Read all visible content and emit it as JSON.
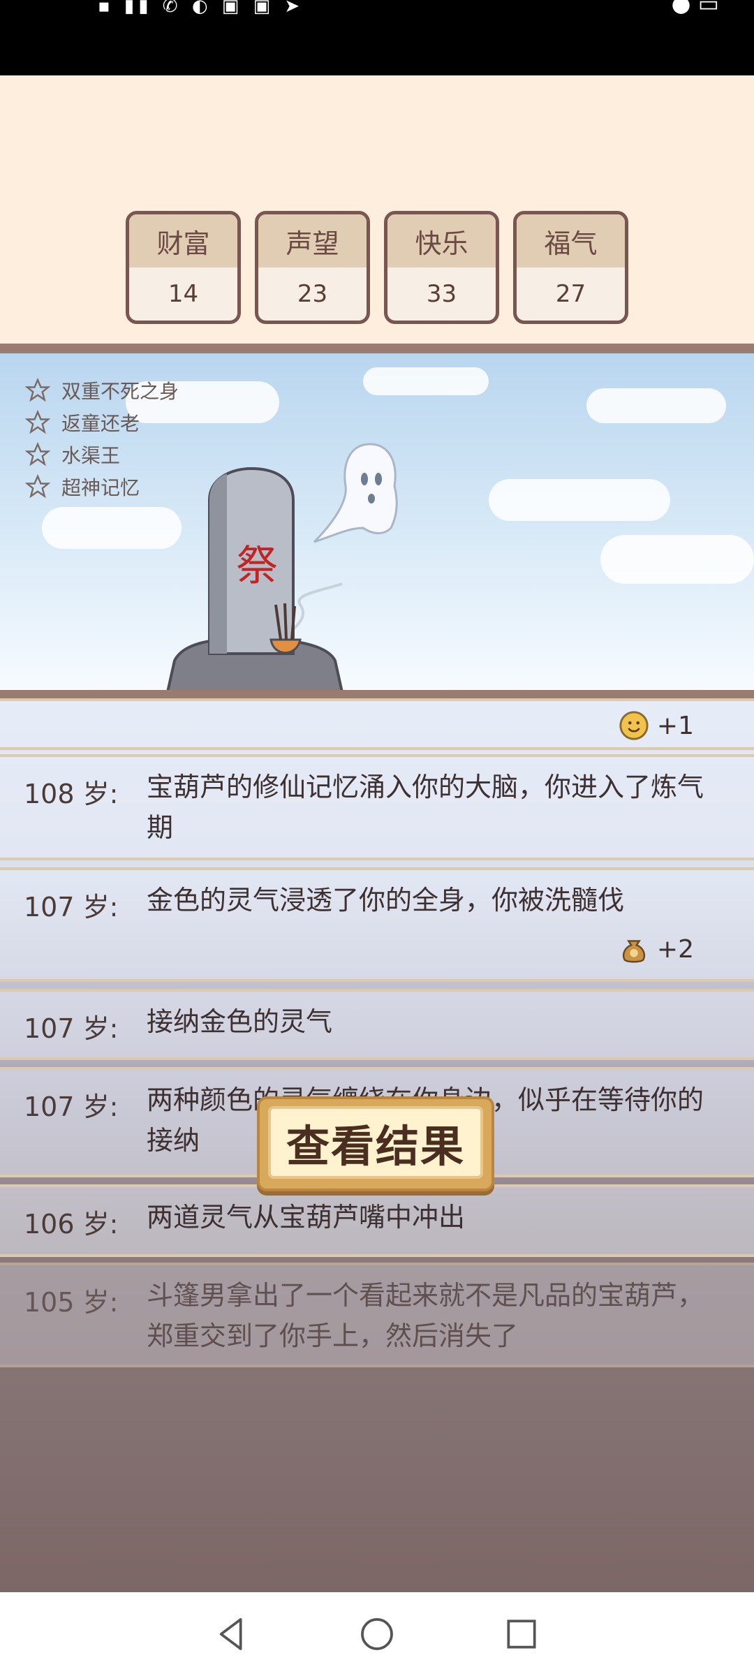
{
  "stats": [
    {
      "label": "财富",
      "value": "14"
    },
    {
      "label": "声望",
      "value": "23"
    },
    {
      "label": "快乐",
      "value": "33"
    },
    {
      "label": "福气",
      "value": "27"
    }
  ],
  "traits": [
    "双重不死之身",
    "返童还老",
    "水渠王",
    "超神记忆"
  ],
  "scene": {
    "tombstone_text": "祭"
  },
  "top_reward": {
    "icon": "smiley-icon",
    "text": "+1"
  },
  "log": [
    {
      "age": "108 岁:",
      "text": "宝葫芦的修仙记忆涌入你的大脑，你进入了炼气期"
    },
    {
      "age": "107 岁:",
      "text": "金色的灵气浸透了你的全身，你被洗髓伐",
      "reward": {
        "icon": "money-bag-icon",
        "text": "+2"
      }
    },
    {
      "age": "107 岁:",
      "text": "接纳金色的灵气"
    },
    {
      "age": "107 岁:",
      "text": "两种颜色的灵气缠绕在你身边，似乎在等待你的接纳"
    },
    {
      "age": "106 岁:",
      "text": "两道灵气从宝葫芦嘴中冲出"
    },
    {
      "age": "105 岁:",
      "text": "斗篷男拿出了一个看起来就不是凡品的宝葫芦，郑重交到了你手上，然后消失了"
    }
  ],
  "result_button": {
    "label": "查看结果"
  },
  "colors": {
    "accent": "#d9a95b",
    "background": "#fdeede",
    "frame": "#7a5650"
  }
}
